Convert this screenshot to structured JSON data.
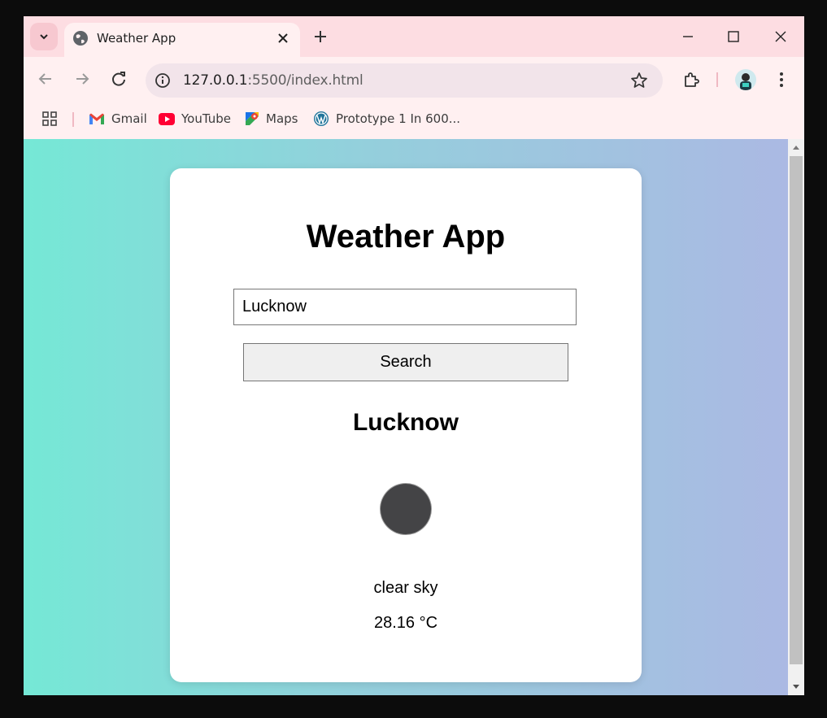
{
  "browser": {
    "tab": {
      "title": "Weather App"
    },
    "address": {
      "host": "127.0.0.1",
      "rest": ":5500/index.html"
    },
    "bookmarks": [
      {
        "label": "Gmail",
        "icon": "gmail-icon"
      },
      {
        "label": "YouTube",
        "icon": "youtube-icon"
      },
      {
        "label": "Maps",
        "icon": "maps-icon"
      },
      {
        "label": "Prototype 1 In 600...",
        "icon": "wordpress-icon"
      }
    ],
    "colors": {
      "tabstrip": "#fddde2",
      "toolbar": "#fff0f1"
    }
  },
  "app": {
    "title": "Weather App",
    "search": {
      "value": "Lucknow",
      "button_label": "Search"
    },
    "result": {
      "city": "Lucknow",
      "icon": "weather-icon",
      "description": "clear sky",
      "temperature": "28.16 °C"
    },
    "colors": {
      "gradient_start": "#75e8d6",
      "gradient_end": "#abb9e3",
      "card": "#ffffff"
    }
  }
}
